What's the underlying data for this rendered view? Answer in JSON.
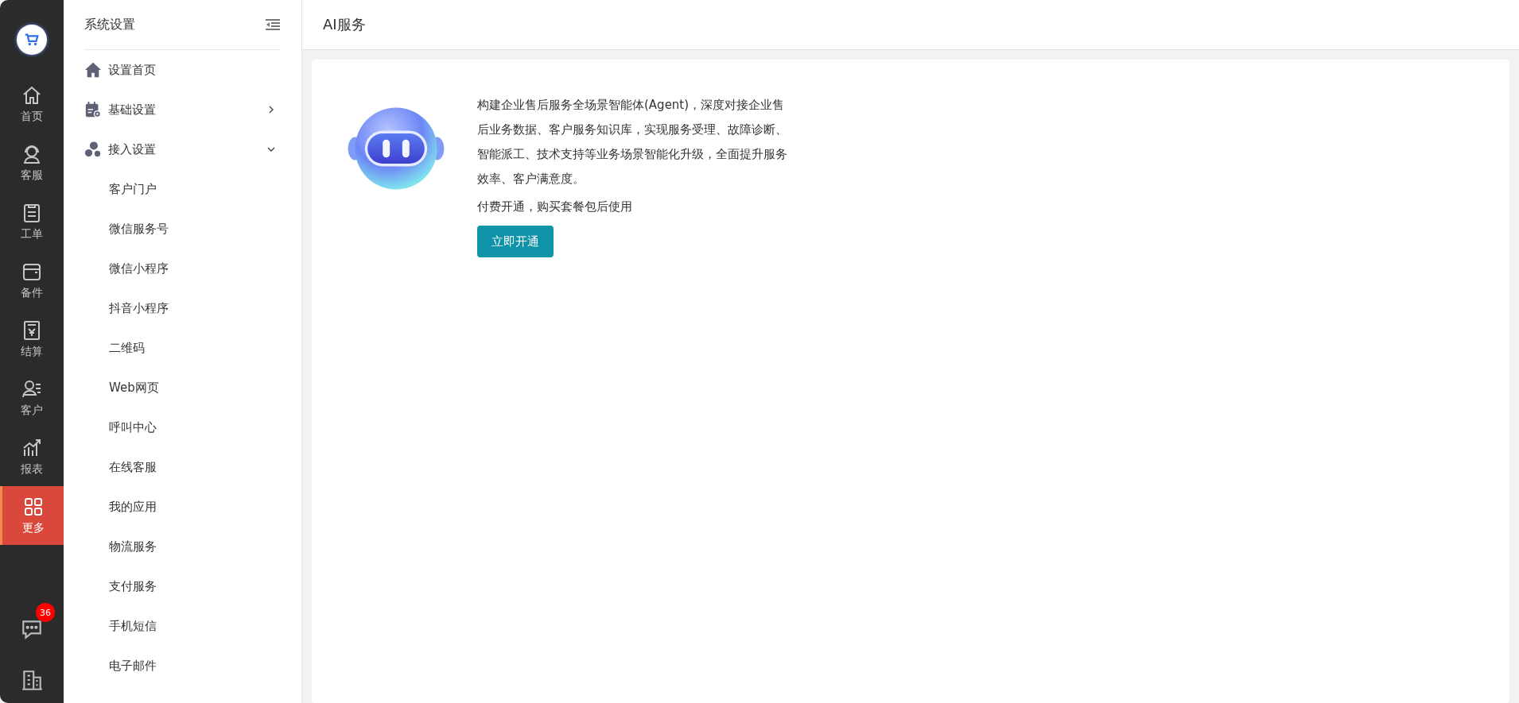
{
  "rail": {
    "items": [
      {
        "label": "首页",
        "selected": false
      },
      {
        "label": "客服",
        "selected": false
      },
      {
        "label": "工单",
        "selected": false
      },
      {
        "label": "备件",
        "selected": false
      },
      {
        "label": "结算",
        "selected": false
      },
      {
        "label": "客户",
        "selected": false
      },
      {
        "label": "报表",
        "selected": false
      },
      {
        "label": "更多",
        "selected": true
      }
    ],
    "message_badge": "36"
  },
  "sidebar": {
    "title": "系统设置",
    "items": [
      {
        "label": "设置首页"
      },
      {
        "label": "基础设置",
        "expanded": false
      },
      {
        "label": "接入设置",
        "expanded": true,
        "children": [
          {
            "label": "客户门户"
          },
          {
            "label": "微信服务号"
          },
          {
            "label": "微信小程序"
          },
          {
            "label": "抖音小程序"
          },
          {
            "label": "二维码"
          },
          {
            "label": "Web网页"
          },
          {
            "label": "呼叫中心"
          },
          {
            "label": "在线客服"
          },
          {
            "label": "我的应用"
          },
          {
            "label": "物流服务"
          },
          {
            "label": "支付服务"
          },
          {
            "label": "手机短信"
          },
          {
            "label": "电子邮件"
          }
        ]
      }
    ]
  },
  "page": {
    "title": "AI服务",
    "description": "构建企业售后服务全场景智能体(Agent)，深度对接企业售后业务数据、客户服务知识库，实现服务受理、故障诊断、智能派工、技术支持等业务场景智能化升级，全面提升服务效率、客户满意度。",
    "note": "付费开通，购买套餐包后使用",
    "button": "立即开通"
  }
}
